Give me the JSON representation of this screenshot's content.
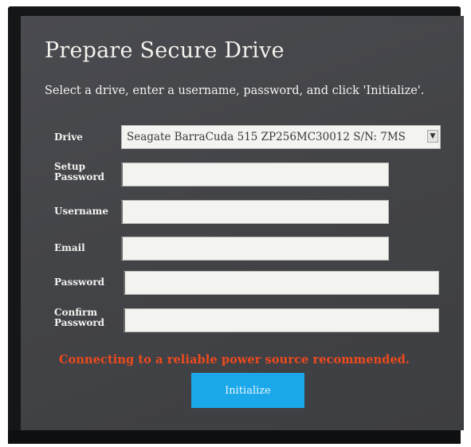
{
  "dialog": {
    "title": "Prepare Secure Drive",
    "subtitle": "Select a drive, enter a username, password, and click 'Initialize'."
  },
  "form": {
    "drive_label": "Drive",
    "drive_selected": "Seagate BarraCuda 515 ZP256MC30012 S/N: 7MS",
    "drive_arrow_icon": "triangle-down-icon",
    "setup_password_label_line1": "Setup",
    "setup_password_label_line2": "Password",
    "setup_password_value": "",
    "username_label": "Username",
    "username_value": "",
    "email_label": "Email",
    "email_value": "",
    "password_label": "Password",
    "password_value": "",
    "confirm_password_label_line1": "Confirm",
    "confirm_password_label_line2": "Password",
    "confirm_password_value": ""
  },
  "warning": {
    "text": "Connecting to a reliable power source recommended.",
    "color": "#ee4a1d"
  },
  "actions": {
    "initialize_label": "Initialize",
    "accent": "#1aa8ea"
  }
}
